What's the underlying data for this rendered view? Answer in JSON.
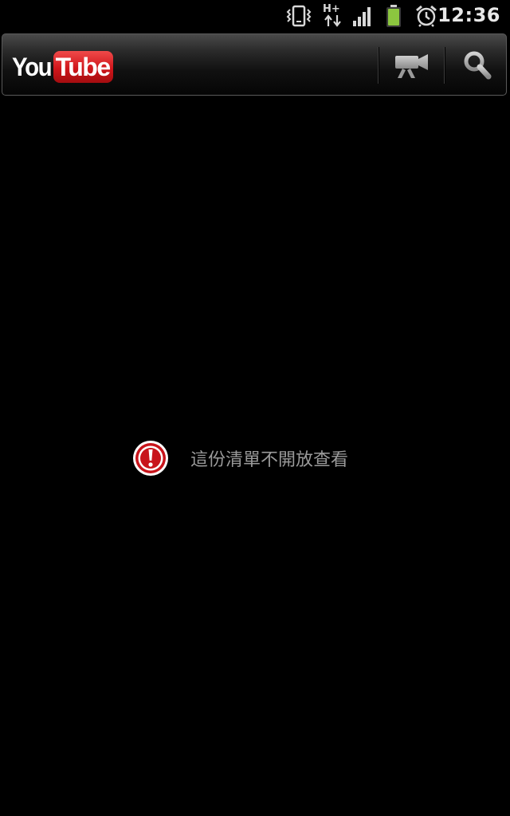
{
  "status_bar": {
    "time": "12:36",
    "network_label": "H+",
    "icons": [
      "vibrate-icon",
      "network-hplus-icon",
      "signal-icon",
      "battery-icon",
      "alarm-icon"
    ],
    "battery_color": "#8cc63f"
  },
  "action_bar": {
    "logo": {
      "you": "You",
      "tube": "Tube"
    },
    "upload_icon": "video-camera-icon",
    "search_icon": "search-icon"
  },
  "message": {
    "icon": "alert-icon",
    "text": "這份清單不開放查看",
    "icon_color": "#c8141b"
  },
  "colors": {
    "background": "#000000",
    "message_text": "#9a9a9a",
    "brand_red": "#d0161b"
  }
}
